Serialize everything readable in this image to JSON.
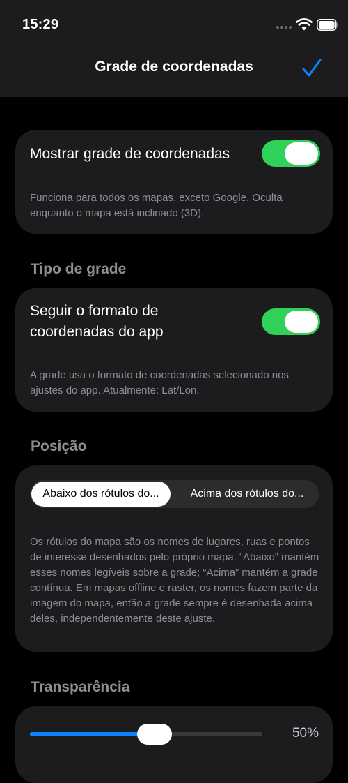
{
  "status_bar": {
    "time": "15:29"
  },
  "nav": {
    "title": "Grade de coordenadas",
    "done_icon": "checkmark-icon"
  },
  "colors": {
    "accent": "#0a84ff",
    "toggle_on": "#30d158",
    "card_background": "#1c1c1e",
    "secondary_text": "#8e8e93"
  },
  "show_grid": {
    "label": "Mostrar grade de coordenadas",
    "enabled": true,
    "note": "Funciona para todos os mapas, exceto Google. Oculta enquanto o mapa está inclinado (3D)."
  },
  "grid_type": {
    "header": "Tipo de grade",
    "label_line1": "Seguir o formato de",
    "label_line2": "coordenadas do app",
    "enabled": true,
    "note": "A grade usa o formato de coordenadas selecionado nos ajustes do app. Atualmente: Lat/Lon."
  },
  "position": {
    "header": "Posição",
    "options": [
      "Abaixo dos rótulos do...",
      "Acima dos rótulos do..."
    ],
    "selected_index": 0,
    "note": "Os rótulos do mapa são os nomes de lugares, ruas e pontos de interesse desenhados pelo próprio mapa. “Abaixo” mantém esses nomes legíveis sobre a grade; “Acima” mantém a grade contínua. Em mapas offline e raster, os nomes fazem parte da imagem do mapa, então a grade sempre é desenhada acima deles, independentemente deste ajuste."
  },
  "transparency": {
    "header": "Transparência",
    "value": 0.5,
    "value_text": "50%"
  }
}
